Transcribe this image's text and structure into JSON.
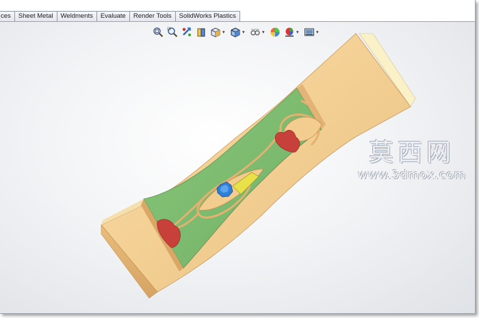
{
  "tabs": [
    "ces",
    "Sheet Metal",
    "Weldments",
    "Evaluate",
    "Render Tools",
    "SolidWorks Plastics"
  ],
  "hud_icons": [
    {
      "name": "zoom-to-fit-icon"
    },
    {
      "name": "zoom-to-area-icon"
    },
    {
      "name": "previous-view-icon"
    },
    {
      "name": "section-view-icon"
    },
    {
      "name": "view-orientation-icon",
      "dropdown": true
    },
    {
      "name": "display-style-icon",
      "dropdown": true
    },
    {
      "name": "hide-show-items-icon",
      "dropdown": true
    },
    {
      "name": "edit-appearance-icon"
    },
    {
      "name": "apply-scene-icon",
      "dropdown": true
    },
    {
      "name": "view-settings-icon",
      "dropdown": true
    }
  ],
  "watermark": {
    "cn": "莫西网",
    "url": "www.3dmox.com"
  },
  "colors": {
    "wood": "#f2cf92",
    "wood_dark": "#d9a867",
    "green": "#7fbf73",
    "heart": "#c8403a",
    "blue": "#2f7fd6",
    "yellow": "#e9e04a"
  }
}
